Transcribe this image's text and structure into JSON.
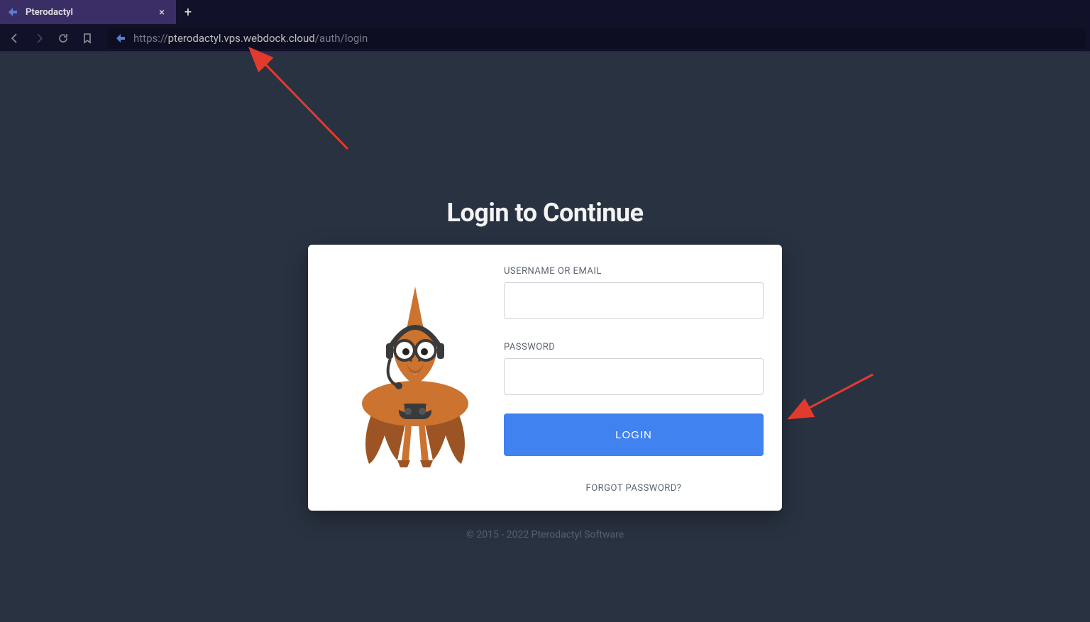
{
  "browser": {
    "tab_title": "Pterodactyl",
    "url_proto": "https://",
    "url_host": "pterodactyl.vps.webdock.cloud",
    "url_path": "/auth/login",
    "close_glyph": "×",
    "new_tab_glyph": "+"
  },
  "login": {
    "heading": "Login to Continue",
    "username_label": "USERNAME OR EMAIL",
    "password_label": "PASSWORD",
    "login_button": "LOGIN",
    "forgot": "FORGOT PASSWORD?"
  },
  "footer": {
    "text": "© 2015 - 2022 Pterodactyl Software"
  },
  "colors": {
    "accent_blue": "#3f82f0",
    "annotation_red": "#e23b2e"
  }
}
